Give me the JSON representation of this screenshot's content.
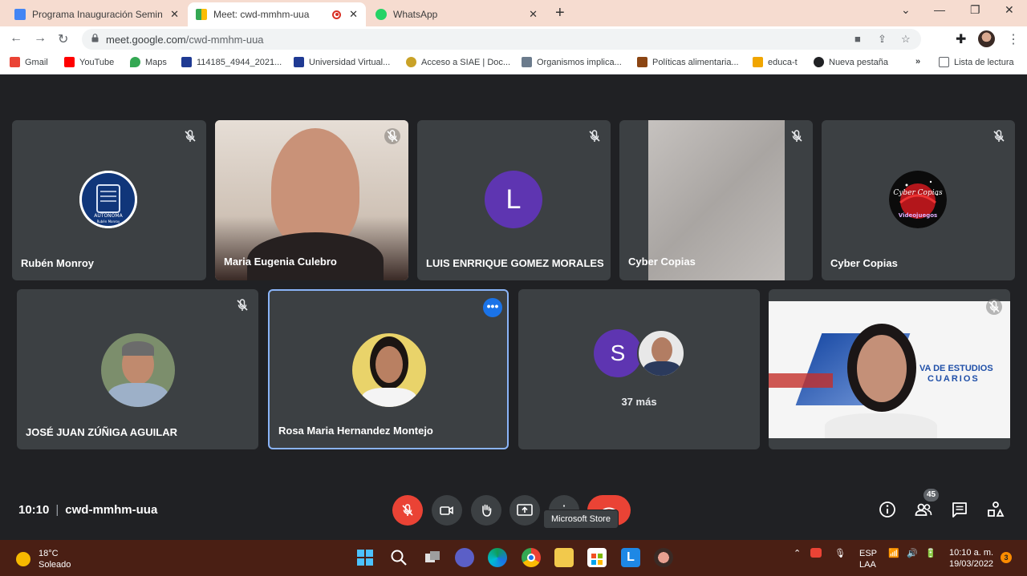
{
  "browser": {
    "tabs": [
      {
        "label": "Programa Inauguración Seminar"
      },
      {
        "label": "Meet: cwd-mmhm-uua"
      },
      {
        "label": "WhatsApp"
      }
    ],
    "url_host": "meet.google.com",
    "url_path": "/cwd-mmhm-uua",
    "bookmarks": [
      {
        "label": "Gmail"
      },
      {
        "label": "YouTube"
      },
      {
        "label": "Maps"
      },
      {
        "label": "114185_4944_2021..."
      },
      {
        "label": "Universidad Virtual..."
      },
      {
        "label": "Acceso a SIAE | Doc..."
      },
      {
        "label": "Organismos implica..."
      },
      {
        "label": "Políticas alimentaria..."
      },
      {
        "label": "educa-t"
      },
      {
        "label": "Nueva pestaña"
      }
    ],
    "bookmarks_overflow": "»",
    "reading_list": "Lista de lectura"
  },
  "meet": {
    "participants": [
      {
        "name": "Rubén Monroy",
        "logo_text": "AUTONOMA",
        "logo_text2": "Rubén Monroy"
      },
      {
        "name": "Maria Eugenia Culebro"
      },
      {
        "name": "LUIS ENRRIQUE GOMEZ MORALES",
        "initial": "L"
      },
      {
        "name": "Cyber Copias"
      },
      {
        "name": "Cyber Copias",
        "logo_text": "Videojuegos",
        "logo_text2": "Cyber Copias"
      },
      {
        "name": "JOSÉ JUAN ZÚÑIGA AGUILAR"
      },
      {
        "name": "Rosa Maria Hernandez Montejo"
      },
      {
        "name": "",
        "initial": "S",
        "more": "37 más"
      },
      {
        "name": "",
        "banner_text": "VA DE ESTUDIOS",
        "banner_text2": "CUARIOS"
      }
    ],
    "time": "10:10",
    "meeting_code": "cwd-mmhm-uua",
    "tooltip": "Microsoft Store",
    "participant_count": "45"
  },
  "taskbar": {
    "weather_temp": "18°C",
    "weather_desc": "Soleado",
    "lang_line1": "ESP",
    "lang_line2": "LAA",
    "clock_time": "10:10 a. m.",
    "clock_date": "19/03/2022",
    "notifications": "3"
  },
  "colors": {
    "accent": "#1a73e8",
    "danger": "#ea4335",
    "tile": "#3c4043",
    "background": "#202124",
    "taskbar": "#4a1f14"
  }
}
